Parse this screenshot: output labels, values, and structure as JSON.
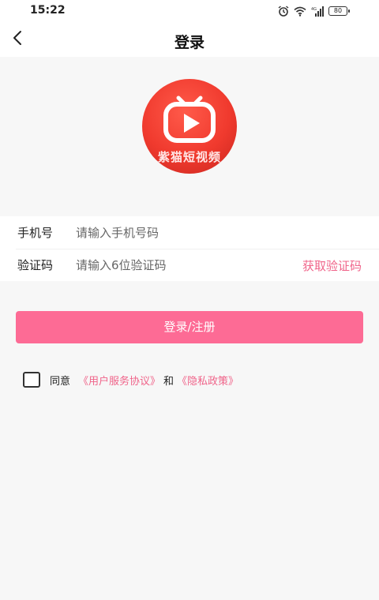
{
  "status_bar": {
    "time": "15:22",
    "battery": "80",
    "icons": [
      "alarm-icon",
      "wifi-icon",
      "signal-icon",
      "battery-icon"
    ]
  },
  "nav": {
    "title": "登录",
    "back_icon": "chevron-left-icon"
  },
  "logo": {
    "text": "紫猫短视频"
  },
  "form": {
    "phone_label": "手机号",
    "phone_placeholder": "请输入手机号码",
    "code_label": "验证码",
    "code_placeholder": "请输入6位验证码",
    "get_code": "获取验证码"
  },
  "login_button": "登录/注册",
  "agreement": {
    "agree": "同意",
    "terms_link": "《用户服务协议》",
    "and": "和",
    "privacy_link": "《隐私政策》"
  },
  "colors": {
    "accent": "#fd6b95",
    "link": "#f0648a",
    "logo_red": "#f03a2e",
    "background": "#f7f7f7"
  }
}
